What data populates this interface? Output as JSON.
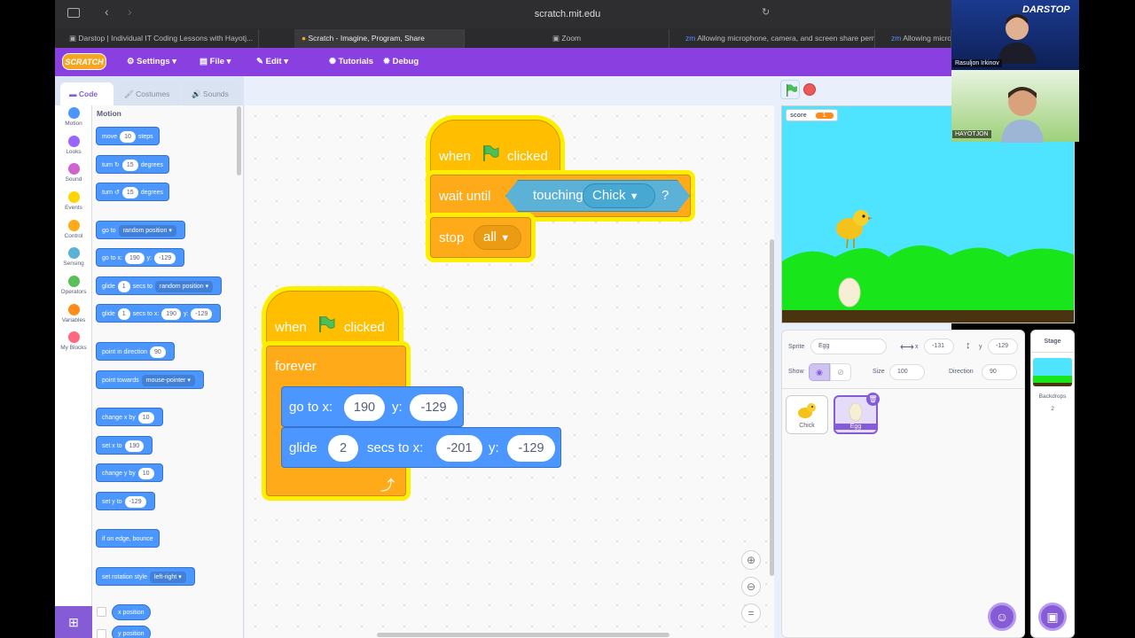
{
  "browser": {
    "url": "scratch.mit.edu",
    "tabs": [
      {
        "label": "Darstop | Individual IT Coding Lessons with Hayotj..."
      },
      {
        "label": "Scratch - Imagine, Program, Share"
      },
      {
        "label": "Zoom"
      },
      {
        "label": "Allowing microphone, camera, and screen share perm..."
      },
      {
        "label": "Allowing microp"
      }
    ]
  },
  "menu": {
    "logo": "SCRATCH",
    "settings": "Settings",
    "file": "File",
    "edit": "Edit",
    "tutorials": "Tutorials",
    "debug": "Debug"
  },
  "editor_tabs": {
    "code": "Code",
    "costumes": "Costumes",
    "sounds": "Sounds"
  },
  "categories": [
    {
      "label": "Motion",
      "color": "#4c97ff"
    },
    {
      "label": "Looks",
      "color": "#9966ff"
    },
    {
      "label": "Sound",
      "color": "#cf63cf"
    },
    {
      "label": "Events",
      "color": "#ffd500"
    },
    {
      "label": "Control",
      "color": "#ffab19"
    },
    {
      "label": "Sensing",
      "color": "#5cb1d6"
    },
    {
      "label": "Operators",
      "color": "#59c059"
    },
    {
      "label": "Variables",
      "color": "#ff8c1a"
    },
    {
      "label": "My Blocks",
      "color": "#ff6680"
    }
  ],
  "palette": {
    "heading": "Motion",
    "move": {
      "a": "move",
      "v": "10",
      "b": "steps"
    },
    "turn_right": {
      "a": "turn",
      "v": "15",
      "b": "degrees"
    },
    "turn_left": {
      "a": "turn",
      "v": "15",
      "b": "degrees"
    },
    "goto": {
      "a": "go to",
      "dd": "random position"
    },
    "gotoxy": {
      "a": "go to x:",
      "x": "190",
      "b": "y:",
      "y": "-129"
    },
    "glide_to": {
      "a": "glide",
      "v": "1",
      "b": "secs to",
      "dd": "random position"
    },
    "glide_xy": {
      "a": "glide",
      "v": "1",
      "b": "secs to x:",
      "x": "190",
      "c": "y:",
      "y": "-129"
    },
    "point_dir": {
      "a": "point in direction",
      "v": "90"
    },
    "point_towards": {
      "a": "point towards",
      "dd": "mouse-pointer"
    },
    "change_x": {
      "a": "change x by",
      "v": "10"
    },
    "set_x": {
      "a": "set x to",
      "v": "190"
    },
    "change_y": {
      "a": "change y by",
      "v": "10"
    },
    "set_y": {
      "a": "set y to",
      "v": "-129"
    },
    "bounce": "if on edge, bounce",
    "rotation": {
      "a": "set rotation style",
      "dd": "left-right"
    },
    "x_position": "x position",
    "y_position": "y position"
  },
  "script1": {
    "when": "when",
    "clicked": "clicked",
    "wait_until": "wait until",
    "touching": "touching",
    "target": "Chick",
    "q": "?",
    "stop": "stop",
    "stop_opt": "all"
  },
  "script2": {
    "when": "when",
    "clicked": "clicked",
    "forever": "forever",
    "goto_a": "go to x:",
    "goto_x": "190",
    "goto_b": "y:",
    "goto_y": "-129",
    "glide_a": "glide",
    "glide_secs": "2",
    "glide_b": "secs to x:",
    "glide_x": "-201",
    "glide_c": "y:",
    "glide_y": "-129"
  },
  "stage": {
    "monitor_label": "score",
    "monitor_value": "1"
  },
  "sprite_info": {
    "sprite_label": "Sprite",
    "sprite_name": "Egg",
    "x_label": "x",
    "x": "-131",
    "y_label": "y",
    "y": "-129",
    "show_label": "Show",
    "size_label": "Size",
    "size": "100",
    "direction_label": "Direction",
    "direction": "90"
  },
  "sprites": [
    {
      "name": "Chick"
    },
    {
      "name": "Egg",
      "selected": true
    }
  ],
  "stage_panel": {
    "title": "Stage",
    "backdrops_label": "Backdrops",
    "backdrops_count": "2"
  },
  "zoom": {
    "brand": "DARSTOP",
    "participant1": "Rasuljon Irkinov",
    "participant2": "HAYOTJON"
  },
  "colors": {
    "accent": "#855cd6",
    "menubar": "#8a3fe0",
    "motion": "#4c97ff",
    "events": "#ffbf00",
    "control": "#ffab19",
    "sensing": "#5cb1d6",
    "highlight": "#ffee00"
  }
}
